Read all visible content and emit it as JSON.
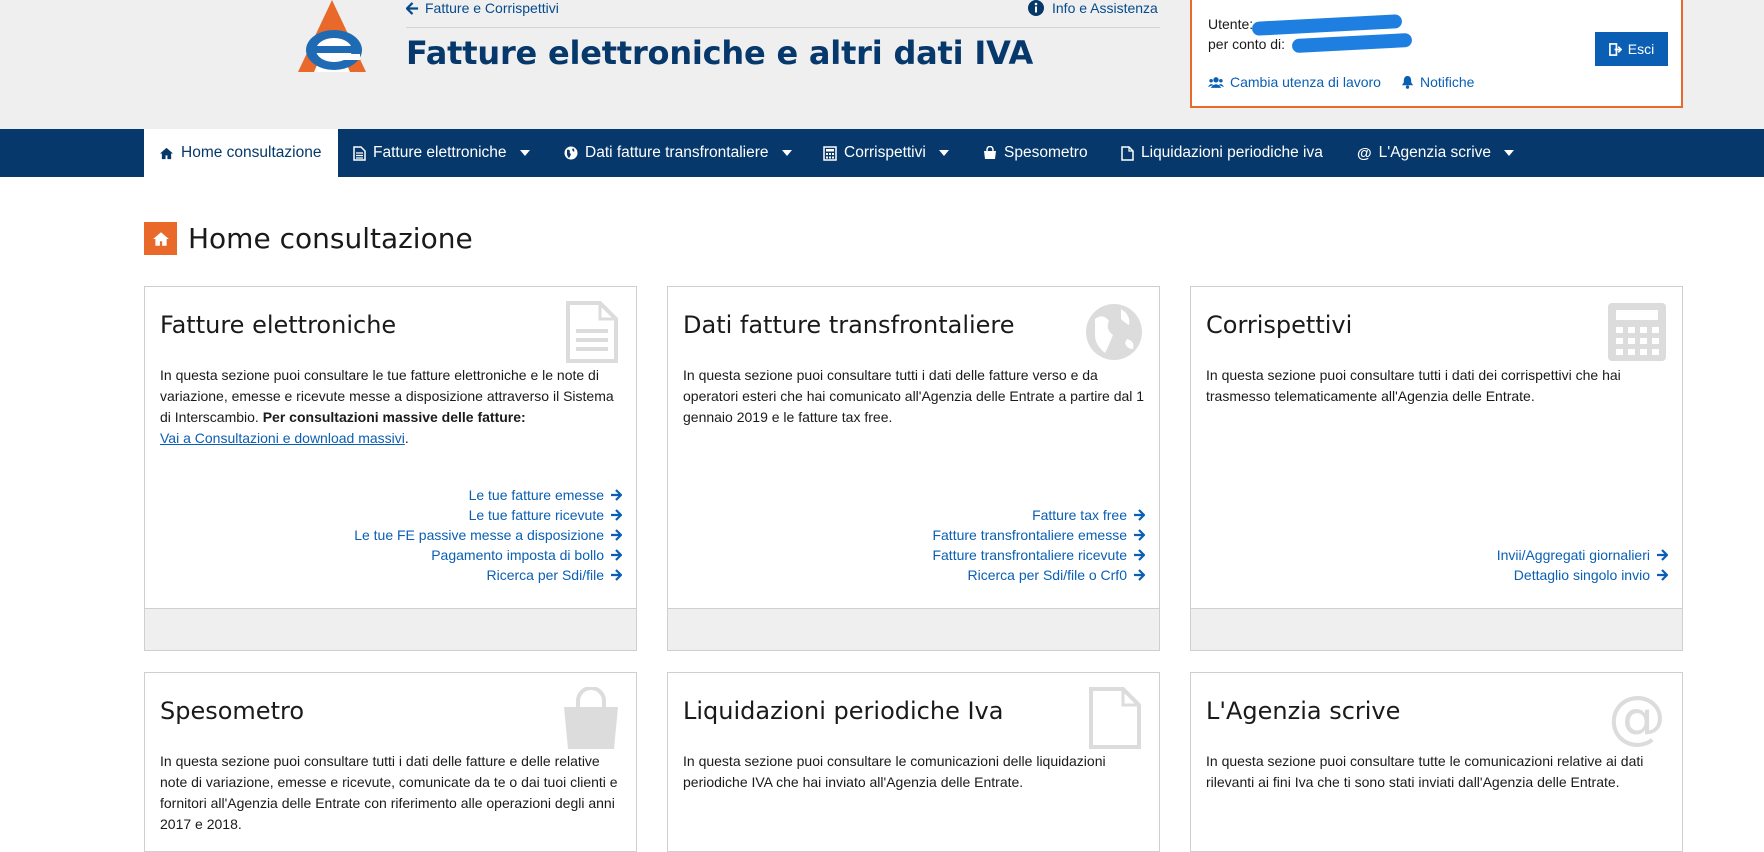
{
  "header": {
    "back_link": "Fatture e Corrispettivi",
    "info_link": "Info e Assistenza",
    "app_title": "Fatture elettroniche e altri dati IVA",
    "user_label": "Utente:",
    "on_behalf_label": "per conto di:",
    "logout_label": "Esci",
    "change_user_label": "Cambia utenza di lavoro",
    "notifications_label": "Notifiche"
  },
  "nav": {
    "items": [
      {
        "label": "Home consultazione",
        "icon": "home-icon",
        "active": true
      },
      {
        "label": "Fatture elettroniche",
        "icon": "document-icon",
        "dropdown": true
      },
      {
        "label": "Dati fatture transfrontaliere",
        "icon": "globe-icon",
        "dropdown": true
      },
      {
        "label": "Corrispettivi",
        "icon": "calculator-icon",
        "dropdown": true
      },
      {
        "label": "Spesometro",
        "icon": "bag-icon"
      },
      {
        "label": "Liquidazioni periodiche iva",
        "icon": "file-icon"
      },
      {
        "label": "L'Agenzia scrive",
        "icon": "at-icon",
        "dropdown": true
      }
    ]
  },
  "page": {
    "title": "Home consultazione"
  },
  "cards": {
    "fatture": {
      "title": "Fatture elettroniche",
      "desc": "In questa sezione puoi consultare le tue fatture elettroniche e le note di variazione, emesse e ricevute messe a disposizione attraverso il Sistema di Interscambio. ",
      "desc_bold": "Per consultazioni massive delle fatture:",
      "desc_link": "Vai a Consultazioni e download massivi",
      "desc_end": ".",
      "links": [
        "Le tue fatture emesse",
        "Le tue fatture ricevute",
        "Le tue FE passive messe a disposizione",
        "Pagamento imposta di bollo",
        "Ricerca per Sdi/file"
      ]
    },
    "transfrontaliere": {
      "title": "Dati fatture transfrontaliere",
      "desc": "In questa sezione puoi consultare tutti i dati delle fatture verso e da operatori esteri che hai comunicato all'Agenzia delle Entrate a partire dal 1 gennaio 2019 e le fatture tax free.",
      "links": [
        "Fatture tax free",
        "Fatture transfrontaliere emesse",
        "Fatture transfrontaliere ricevute",
        "Ricerca per Sdi/file o Crf0"
      ]
    },
    "corrispettivi": {
      "title": "Corrispettivi",
      "desc": "In questa sezione puoi consultare tutti i dati dei corrispettivi che hai trasmesso telematicamente all'Agenzia delle Entrate.",
      "links": [
        "Invii/Aggregati giornalieri",
        "Dettaglio singolo invio"
      ]
    },
    "spesometro": {
      "title": "Spesometro",
      "desc": "In questa sezione puoi consultare tutti i dati delle fatture e delle relative note di variazione, emesse e ricevute, comunicate da te o dai tuoi clienti e fornitori all'Agenzia delle Entrate con riferimento alle operazioni degli anni 2017 e 2018."
    },
    "liquidazioni": {
      "title": "Liquidazioni periodiche Iva",
      "desc": "In questa sezione puoi consultare le comunicazioni delle liquidazioni periodiche IVA che hai inviato all'Agenzia delle Entrate."
    },
    "agenzia": {
      "title": "L'Agenzia scrive",
      "desc": "In questa sezione puoi consultare tutte le comunicazioni relative ai dati rilevanti ai fini Iva che ti sono stati inviati dall'Agenzia delle Entrate."
    }
  },
  "colors": {
    "primary": "#06386b",
    "accent": "#e8692a",
    "link": "#0a5fb4",
    "panel": "#efefef"
  }
}
